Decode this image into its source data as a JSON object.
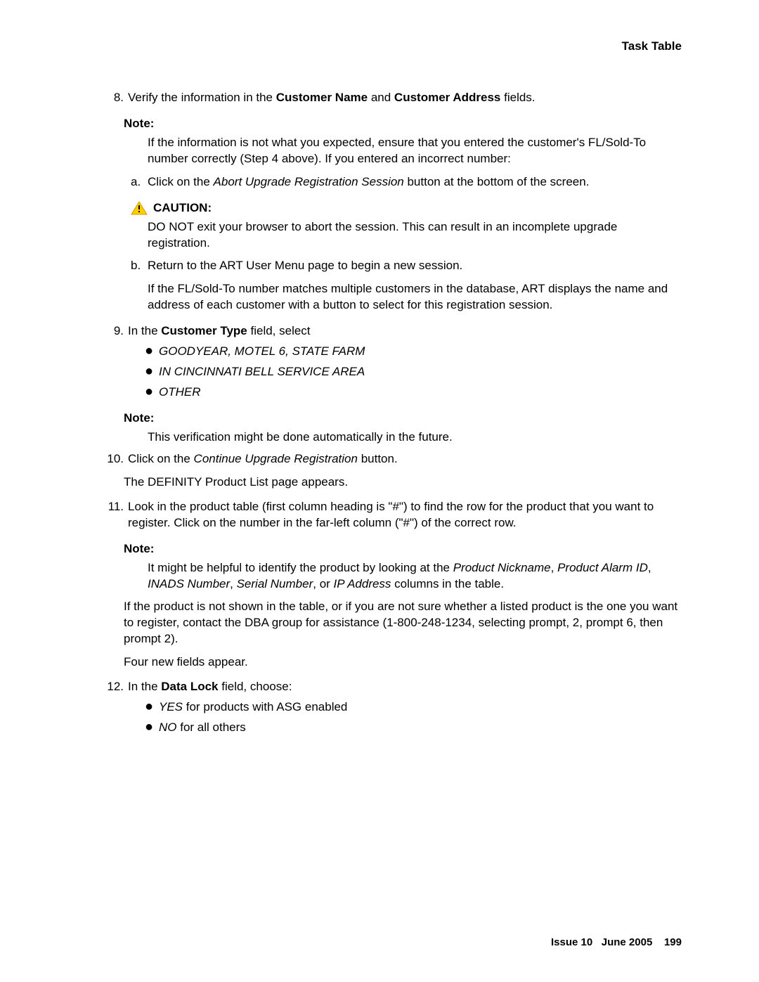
{
  "header": {
    "title": "Task Table"
  },
  "step8": {
    "number": "8.",
    "text_pre": "Verify the information in the ",
    "field1": "Customer Name",
    "mid": " and ",
    "field2": "Customer Address",
    "text_post": " fields.",
    "note_label": "Note:",
    "note_text": "If the information is not what you expected, ensure that you entered the customer's FL/Sold-To number correctly (Step 4 above). If you entered an incorrect number:",
    "a": {
      "letter": "a.",
      "pre": "Click on the ",
      "it": "Abort Upgrade Registration Session",
      "post": " button at the bottom of the screen."
    },
    "caution_label": "CAUTION:",
    "caution_text": "DO NOT exit your browser to abort the session. This can result in an incomplete upgrade registration.",
    "b": {
      "letter": "b.",
      "text": "Return to the ART User Menu page to begin a new session."
    },
    "followup": "If the FL/Sold-To number matches multiple customers in the database, ART displays the name and address of each customer with a button to select for this registration session."
  },
  "step9": {
    "number": "9.",
    "pre": "In the ",
    "bold": "Customer Type",
    "post": " field, select",
    "bullets": [
      "GOODYEAR, MOTEL 6, STATE FARM",
      "IN CINCINNATI BELL SERVICE AREA",
      "OTHER"
    ],
    "note_label": "Note:",
    "note_text": "This verification might be done automatically in the future."
  },
  "step10": {
    "number": "10.",
    "pre": "Click on the ",
    "it": "Continue Upgrade Registration",
    "post": " button.",
    "follow": "The DEFINITY Product List page appears."
  },
  "step11": {
    "number": "11.",
    "text": "Look in the product table (first column heading is \"#\") to find the row for the product that you want to register. Click on the number in the far-left column (\"#\") of the correct row.",
    "note_label": "Note:",
    "note_pre": "It might be helpful to identify the product by looking at the ",
    "i1": "Product Nickname",
    "sep1": ", ",
    "i2": "Product Alarm ID",
    "sep2": ", ",
    "i3": "INADS Number",
    "sep3": ", ",
    "i4": "Serial Number",
    "sep4": ", or ",
    "i5": "IP Address",
    "note_post": " columns in the table.",
    "para2": "If the product is not shown in the table, or if you are not sure whether a listed product is the one you want to register, contact the DBA group for assistance (1-800-248-1234, selecting prompt, 2, prompt 6, then prompt 2).",
    "para3": "Four new fields appear."
  },
  "step12": {
    "number": "12.",
    "pre": "In the ",
    "bold": "Data Lock",
    "post": " field, choose:",
    "bullets": [
      {
        "it": "YES",
        "rest": " for products with ASG enabled"
      },
      {
        "it": "NO",
        "rest": " for all others"
      }
    ]
  },
  "footer": {
    "issue": "Issue 10",
    "date": "June 2005",
    "page": "199"
  }
}
